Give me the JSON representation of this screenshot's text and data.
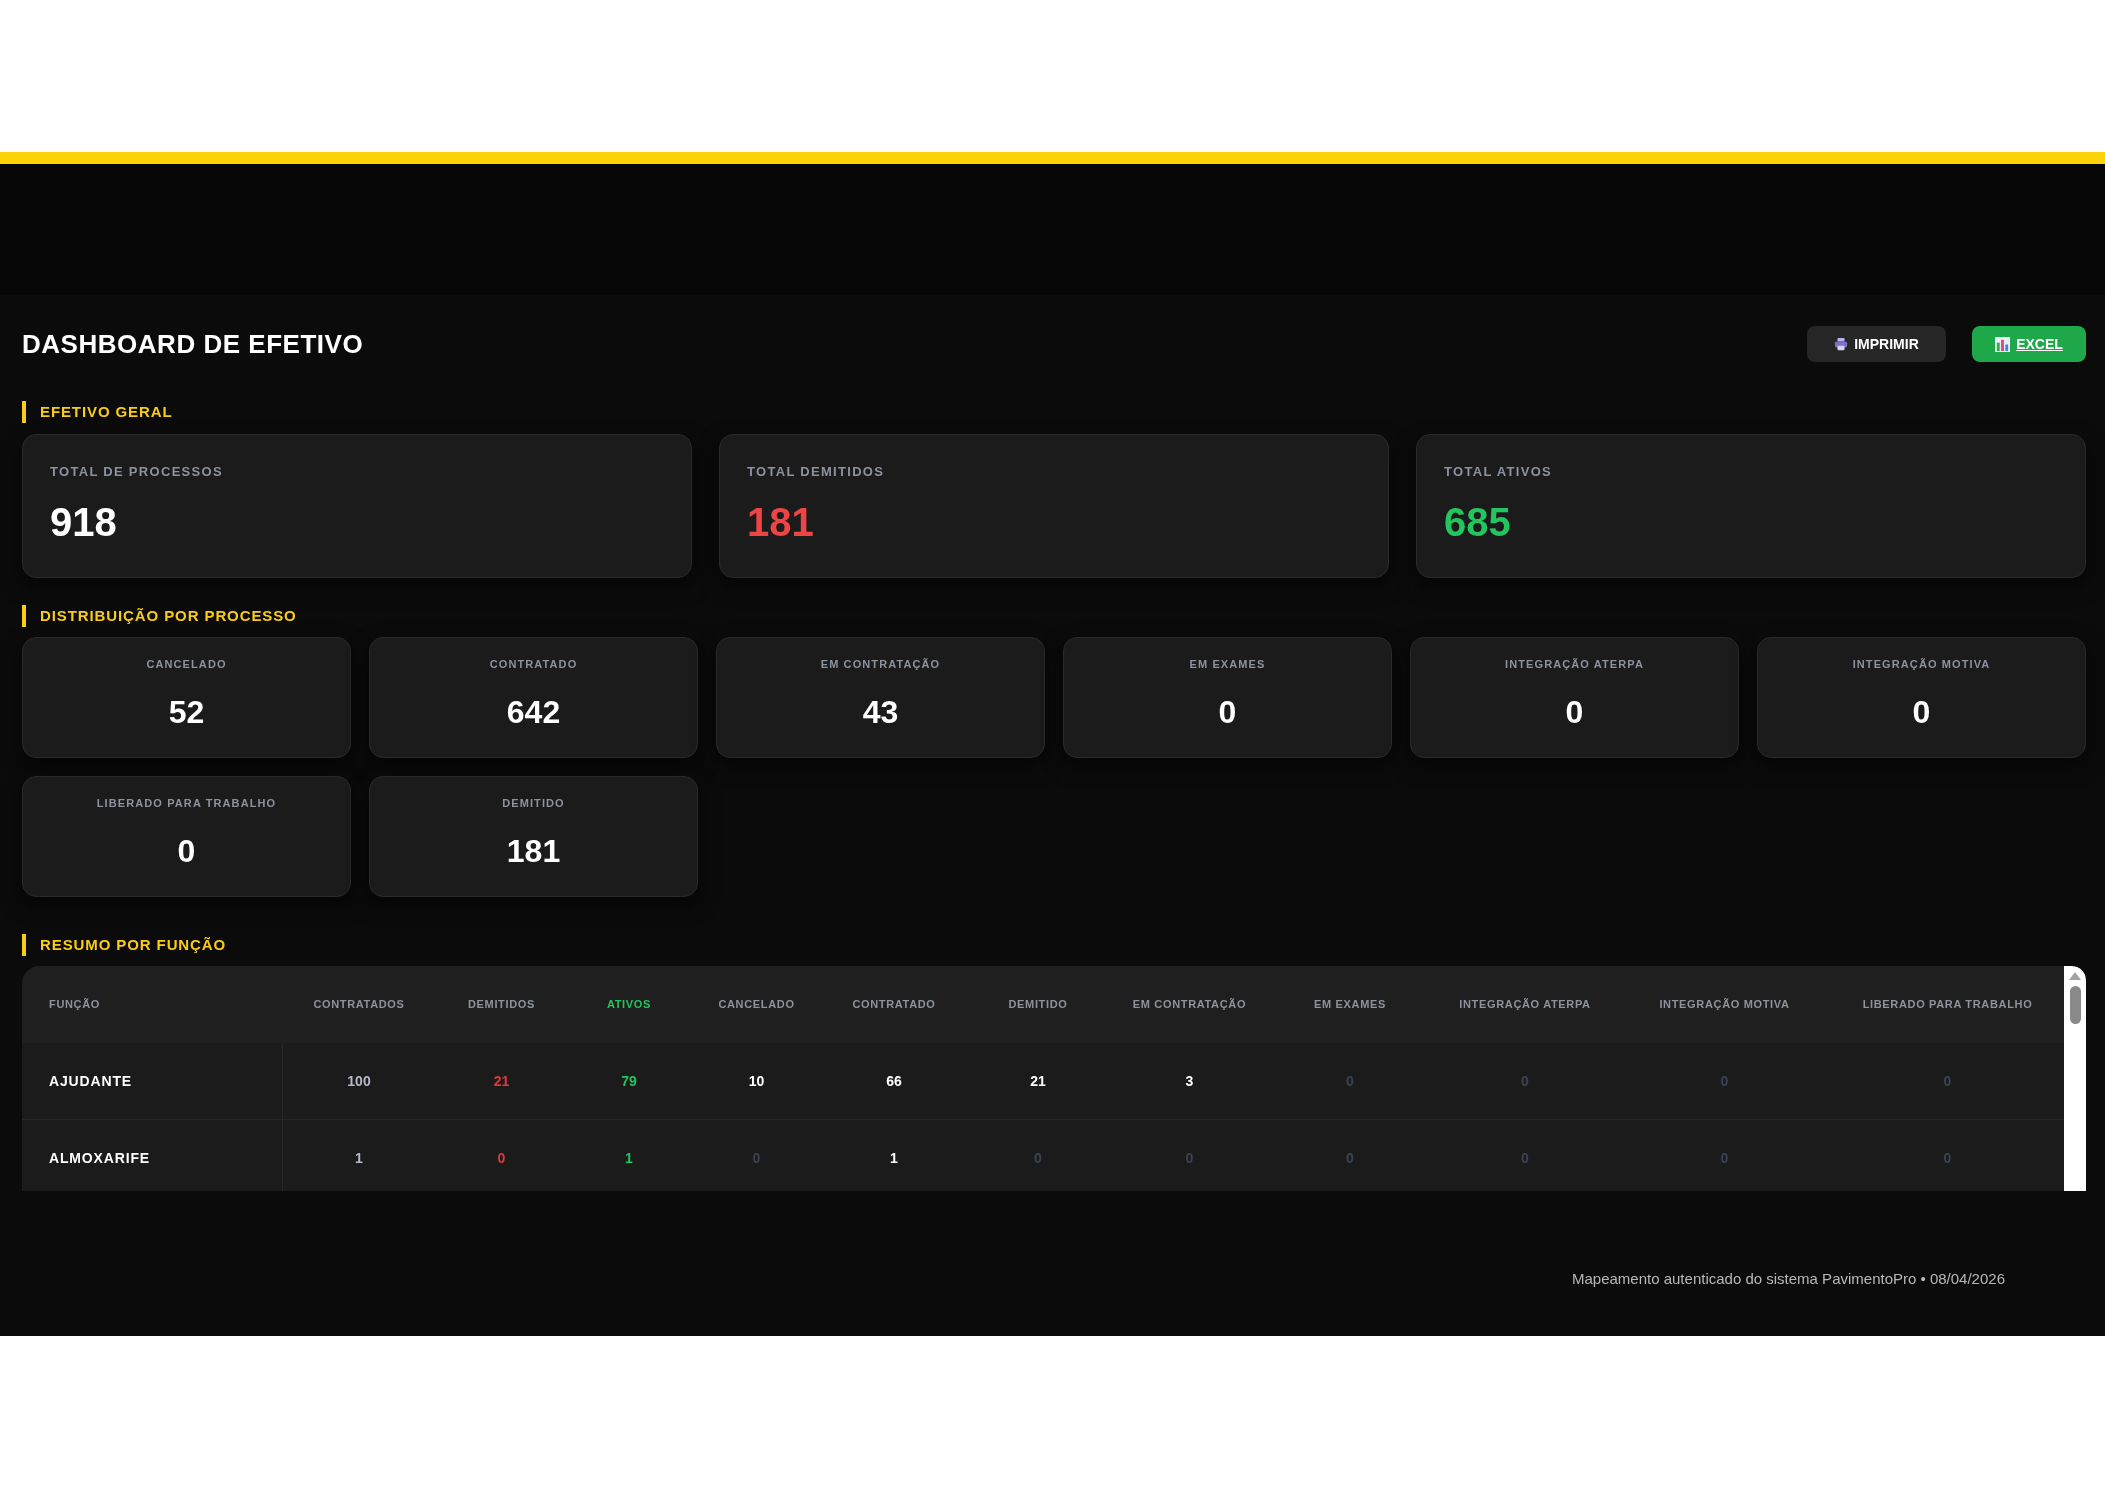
{
  "header": {
    "title": "DASHBOARD DE EFETIVO",
    "actions": [
      {
        "kind": "print",
        "label": "IMPRIMIR"
      },
      {
        "kind": "excel",
        "label": "EXCEL"
      }
    ]
  },
  "efetivo_geral": {
    "title": "EFETIVO GERAL",
    "cards": [
      {
        "label": "TOTAL DE PROCESSOS",
        "value": "918",
        "color": "#ffffff"
      },
      {
        "label": "TOTAL DEMITIDOS",
        "value": "181",
        "color": "#ef4444"
      },
      {
        "label": "TOTAL ATIVOS",
        "value": "685",
        "color": "#22c55e"
      }
    ]
  },
  "distribuicao": {
    "title": "DISTRIBUIÇÃO POR PROCESSO",
    "cards": [
      {
        "label": "CANCELADO",
        "value": "52"
      },
      {
        "label": "CONTRATADO",
        "value": "642"
      },
      {
        "label": "EM CONTRATAÇÃO",
        "value": "43"
      },
      {
        "label": "EM EXAMES",
        "value": "0"
      },
      {
        "label": "INTEGRAÇÃO ATERPA",
        "value": "0"
      },
      {
        "label": "INTEGRAÇÃO MOTIVA",
        "value": "0"
      },
      {
        "label": "LIBERADO PARA TRABALHO",
        "value": "0"
      },
      {
        "label": "DEMITIDO",
        "value": "181"
      }
    ]
  },
  "resumo": {
    "title": "RESUMO POR FUNÇÃO",
    "table": {
      "columns": [
        {
          "label": "FUNÇÃO",
          "kind": "name"
        },
        {
          "label": "CONTRATADOS",
          "kind": "total"
        },
        {
          "label": "DEMITIDOS",
          "kind": "dismissed"
        },
        {
          "label": "ATIVOS",
          "kind": "active"
        },
        {
          "label": "CANCELADO",
          "kind": "process"
        },
        {
          "label": "CONTRATADO",
          "kind": "process"
        },
        {
          "label": "DEMITIDO",
          "kind": "process"
        },
        {
          "label": "EM CONTRATAÇÃO",
          "kind": "process"
        },
        {
          "label": "EM EXAMES",
          "kind": "process"
        },
        {
          "label": "INTEGRAÇÃO ATERPA",
          "kind": "process"
        },
        {
          "label": "INTEGRAÇÃO MOTIVA",
          "kind": "process"
        },
        {
          "label": "LIBERADO PARA TRABALHO",
          "kind": "process"
        }
      ],
      "rows": [
        {
          "cells": [
            {
              "text": "AJUDANTE",
              "dim": false
            },
            {
              "text": "100",
              "dim": false
            },
            {
              "text": "21",
              "dim": false
            },
            {
              "text": "79",
              "dim": false
            },
            {
              "text": "10",
              "dim": false
            },
            {
              "text": "66",
              "dim": false
            },
            {
              "text": "21",
              "dim": false
            },
            {
              "text": "3",
              "dim": false
            },
            {
              "text": "0",
              "dim": true
            },
            {
              "text": "0",
              "dim": true
            },
            {
              "text": "0",
              "dim": true
            },
            {
              "text": "0",
              "dim": true
            }
          ]
        },
        {
          "cells": [
            {
              "text": "ALMOXARIFE",
              "dim": false
            },
            {
              "text": "1",
              "dim": false
            },
            {
              "text": "0",
              "dim": false
            },
            {
              "text": "1",
              "dim": false
            },
            {
              "text": "0",
              "dim": true
            },
            {
              "text": "1",
              "dim": false
            },
            {
              "text": "0",
              "dim": true
            },
            {
              "text": "0",
              "dim": true
            },
            {
              "text": "0",
              "dim": true
            },
            {
              "text": "0",
              "dim": true
            },
            {
              "text": "0",
              "dim": true
            },
            {
              "text": "0",
              "dim": true
            }
          ]
        }
      ]
    }
  },
  "footer": {
    "text": "Mapeamento autenticado do sistema PavimentoPro • 08/04/2026"
  }
}
